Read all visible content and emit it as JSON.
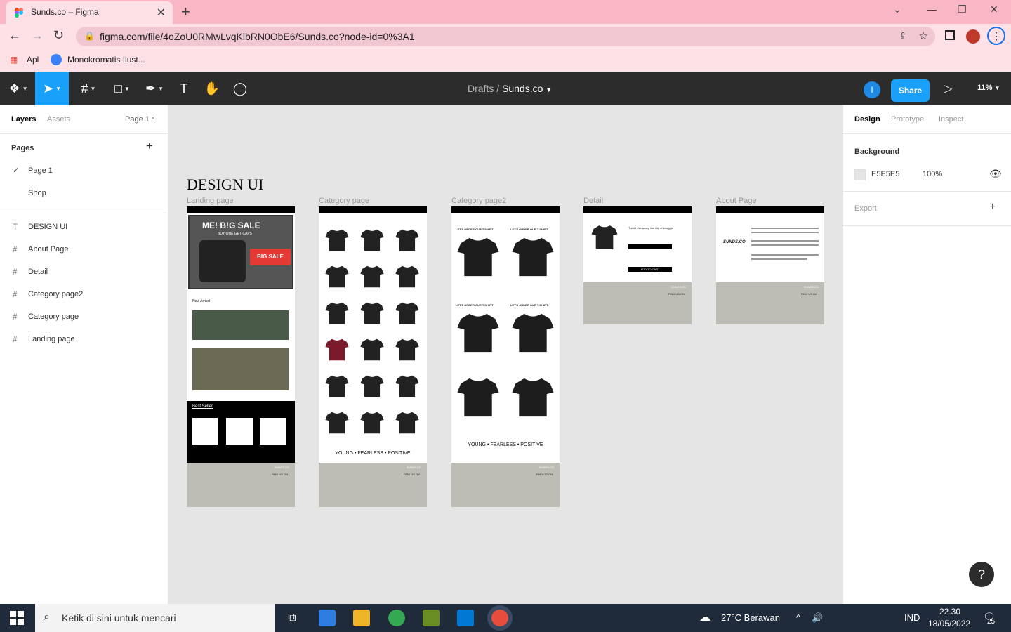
{
  "browser": {
    "tab_title": "Sunds.co – Figma",
    "url": "figma.com/file/4oZoU0RMwLvqKlbRN0ObE6/Sunds.co?node-id=0%3A1",
    "bookmarks": [
      "Apl",
      "Monokromatis Ilust..."
    ]
  },
  "toolbar": {
    "breadcrumb_parent": "Drafts",
    "breadcrumb_sep": "/",
    "file_name": "Sunds.co",
    "avatar_initial": "I",
    "share_label": "Share",
    "zoom": "11%"
  },
  "left_panel": {
    "tabs": [
      "Layers",
      "Assets"
    ],
    "page_selector": "Page 1",
    "pages_title": "Pages",
    "pages": [
      "Page 1",
      "Shop"
    ],
    "layers": [
      {
        "icon": "T",
        "label": "DESIGN UI"
      },
      {
        "icon": "#",
        "label": "About Page"
      },
      {
        "icon": "#",
        "label": "Detail"
      },
      {
        "icon": "#",
        "label": "Category page2"
      },
      {
        "icon": "#",
        "label": "Category page"
      },
      {
        "icon": "#",
        "label": "Landing page"
      }
    ]
  },
  "right_panel": {
    "tabs": [
      "Design",
      "Prototype",
      "Inspect"
    ],
    "background_title": "Background",
    "bg_color": "E5E5E5",
    "bg_opacity": "100%",
    "export_title": "Export"
  },
  "canvas": {
    "title": "DESIGN UI",
    "frames": [
      "Landing page",
      "Category page",
      "Category page2",
      "Detail",
      "About Page"
    ],
    "slogan": "YOUNG • FEARLESS • POSITIVE",
    "banner_text": "ME! B!G SALE",
    "banner_sub": "BUY ONE GET CAPS",
    "big_sale": "BIG SALE",
    "new_arrival": "New Arrival",
    "best_seller": "Best Seller",
    "order_text": "LET'S ORDER OUR T-SHIRT",
    "find_us": "FIND US ON",
    "logo_text": "SUNDS.CO",
    "detail_title": "T-shirt Karawang the city of struggle",
    "add_to_cart": "ADD TO CART"
  },
  "taskbar": {
    "search_placeholder": "Ketik di sini untuk mencari",
    "weather": "27°C  Berawan",
    "lang": "IND",
    "time": "22.30",
    "date": "18/05/2022",
    "notif_count": "25"
  },
  "colors": {
    "chrome_pink": "#f9b6c4",
    "figma_blue": "#18a0fb",
    "figma_dark": "#2c2c2c",
    "canvas_bg": "#e5e5e5"
  }
}
